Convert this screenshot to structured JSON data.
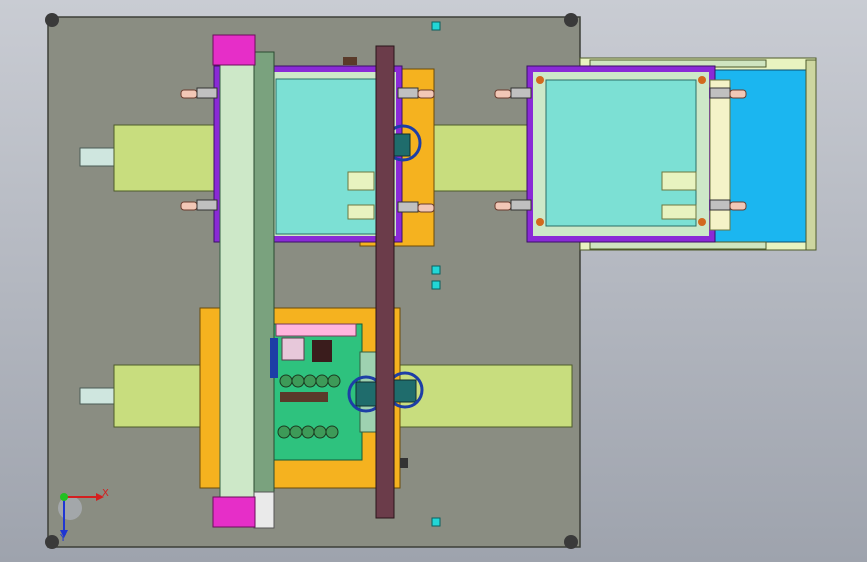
{
  "viewport": {
    "background_top": "#c9ccd3",
    "background_bottom": "#9ea3ad"
  },
  "triad": {
    "x_label": "X",
    "y_label": "Y",
    "x_color": "#d41f1f",
    "y_color": "#1f36d4",
    "z_color": "#22c022"
  },
  "colors": {
    "base_plate": "#8a8d82",
    "base_plate_edge": "#3c3f38",
    "rail_green": "#c8dd7e",
    "rail_dark": "#6e8c5a",
    "beam_light": "#cde8c8",
    "beam_dark": "#7aa27e",
    "crossbar": "#6b3c4a",
    "magenta": "#e62ec8",
    "orange": "#f5b21f",
    "purple": "#8a2ad6",
    "teal": "#7ce0d4",
    "pcb_green": "#2ec27e",
    "blue": "#1bb6f0",
    "ring": "#1d3ea6",
    "cyan_marker": "#22d6d6",
    "cream": "#f4f3c8"
  }
}
